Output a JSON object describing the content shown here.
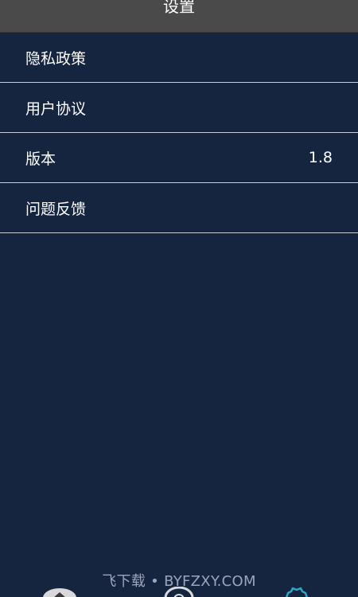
{
  "header": {
    "title": "设置"
  },
  "settings": {
    "items": [
      {
        "label": "隐私政策",
        "value": ""
      },
      {
        "label": "用户协议",
        "value": ""
      },
      {
        "label": "版本",
        "value": "1.8"
      },
      {
        "label": "问题反馈",
        "value": ""
      }
    ]
  },
  "watermark": {
    "text": "飞下载 • BYFZXY.COM"
  },
  "tabbar": {
    "icons": [
      "home-icon",
      "compass-icon",
      "gear-icon"
    ],
    "active_color": "#2ea7c9"
  },
  "colors": {
    "background": "#15243f",
    "header": "#4a4a4a",
    "divider": "#c9ced6",
    "text": "#ffffff"
  }
}
